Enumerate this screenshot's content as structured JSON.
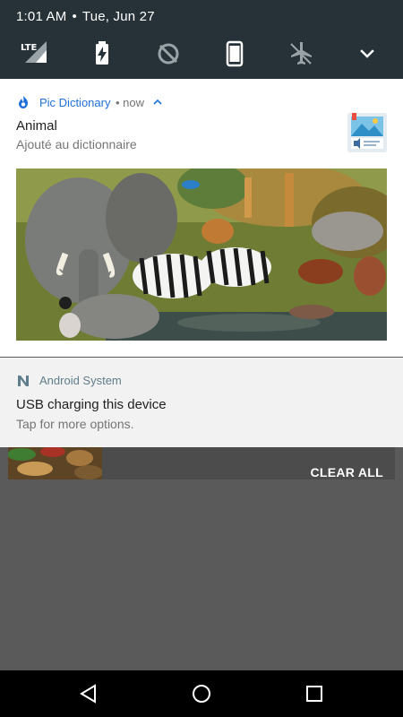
{
  "status_bar": {
    "time": "1:01 AM",
    "separator": "•",
    "date": "Tue, Jun 27"
  },
  "quick_settings": {
    "icons": [
      "lte-signal-icon",
      "battery-charging-icon",
      "data-saver-icon",
      "device-icon",
      "airplane-mode-icon",
      "expand-icon"
    ],
    "lte_label": "LTE"
  },
  "notification_app": {
    "app_name": "Pic Dictionary",
    "meta": "• now",
    "title": "Animal",
    "text": "Ajouté au dictionnaire",
    "accent": "#1e6fd9"
  },
  "notification_system": {
    "app_name": "Android System",
    "title": "USB charging this device",
    "text": "Tap for more options."
  },
  "shade": {
    "clear_all": "CLEAR ALL"
  },
  "navbar": {
    "icons": [
      "back-icon",
      "home-icon",
      "recents-icon"
    ]
  }
}
